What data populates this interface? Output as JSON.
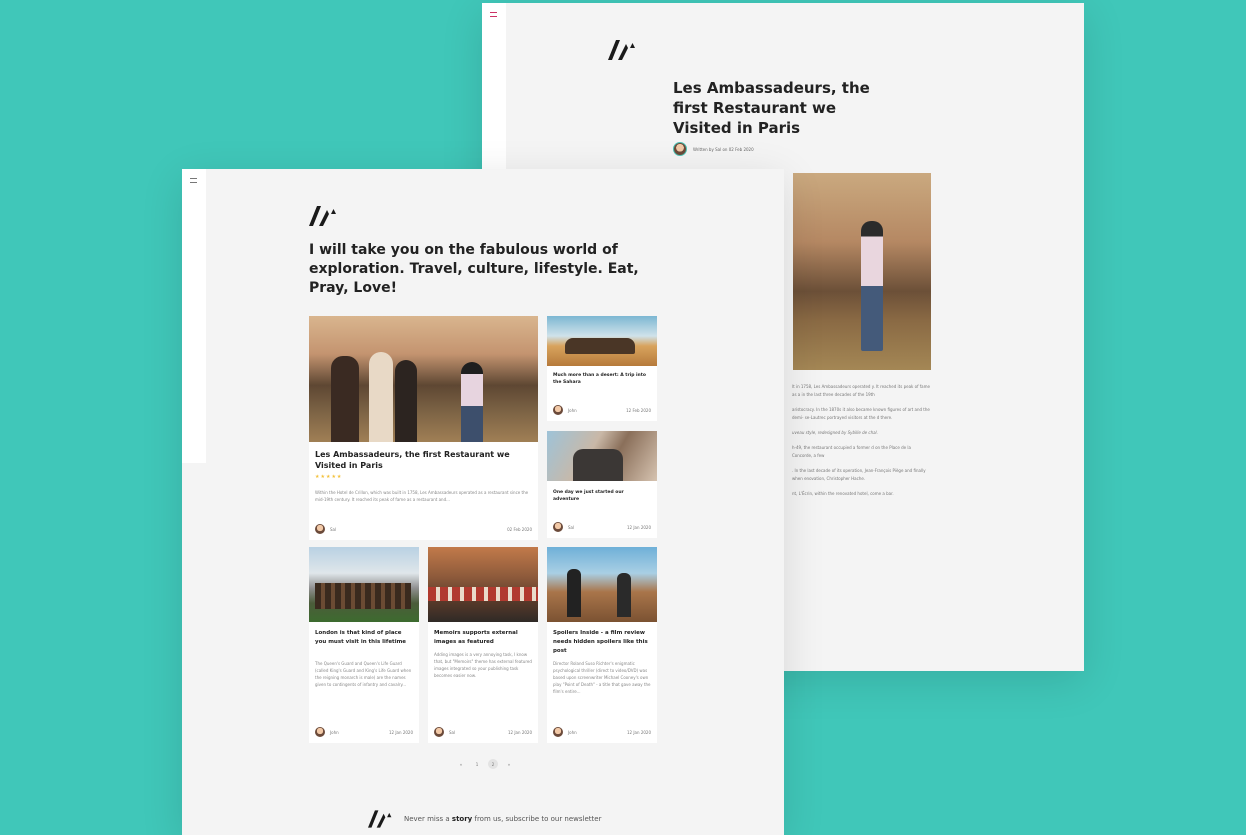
{
  "back_page": {
    "article_title": "Les Ambassadeurs, the first Restaurant we Visited in Paris",
    "byline": "Written by Sal on 02 Feb 2020",
    "body": [
      "lt in 1758, Les Ambassadeurs operated y. It reached its peak of fame as a in the last three decades of the 19th",
      "aristocracy. In the 1870s it also became known figures of art and the demi- se-Lautrec portrayed visitors at the d there.",
      "uveau style, redesigned by Sybille de chal.",
      "h-49, the restaurant occupied a former d on the Place de la Concorde, a few",
      ". In the last decade of its operation, Jean-François Piège and finally when enovation, Christopher Hache.",
      "nt, L'Écrin, within the renovated hotel, come a bar."
    ]
  },
  "front_page": {
    "headline": "I will take you on the fabulous world of exploration. Travel, culture, lifestyle. Eat, Pray, Love!",
    "featured": {
      "title": "Les Ambassadeurs, the first Restaurant we Visited in Paris",
      "stars": "★★★★★",
      "excerpt": "Within the Hotel de Crillon, which was built in 1758, Les Ambassadeurs operated as a restaurant since the mid-19th century. It reached its peak of fame as a restaurant and...",
      "author": "Sal",
      "date": "02 Feb 2020"
    },
    "side_cards": [
      {
        "title": "Much more than a desert: A trip into the Sahara",
        "author": "John",
        "date": "12 Feb 2020"
      },
      {
        "title": "One day we just started our adventure",
        "author": "Sal",
        "date": "12 Jan 2020"
      }
    ],
    "bottom_cards": [
      {
        "title": "London is that kind of place you must visit in this lifetime",
        "excerpt": "The Queen's Guard and Queen's Life Guard (called King's Guard and King's Life Guard when the reigning monarch is male) are the names given to contingents of infantry and cavalry...",
        "author": "John",
        "date": "12 Jan 2020"
      },
      {
        "title": "Memoirs supports external images as featured",
        "excerpt": "Adding images is a very annoying task, I know that, but \"Memoirs\" theme has external featured images integrated so your publishing task becomes easier now.",
        "author": "Sal",
        "date": "12 Jan 2020"
      },
      {
        "title": "Spoilers Inside - a film review needs hidden spoilers like this post",
        "excerpt": "Director Roland Suso Richter's enigmatic psychological thriller (direct to video/DVD) was based upon screenwriter Michael Cooney's own play \"Point of Death\" - a title that gave away the film's entire...",
        "author": "John",
        "date": "12 Jan 2020"
      }
    ],
    "pagination": {
      "prev": "«",
      "page_1": "1",
      "page_2": "2",
      "next": "»"
    },
    "newsletter": {
      "before": "Never miss a",
      "bold": "story",
      "after": "from us, subscribe to our newsletter"
    }
  },
  "colors": {
    "background": "#40c7b9",
    "page": "#f4f4f4",
    "card": "#ffffff",
    "stars": "#f3c13a",
    "menu_accent": "#cc3366"
  },
  "icons": [
    "menu-icon",
    "logo-icon",
    "avatar"
  ]
}
